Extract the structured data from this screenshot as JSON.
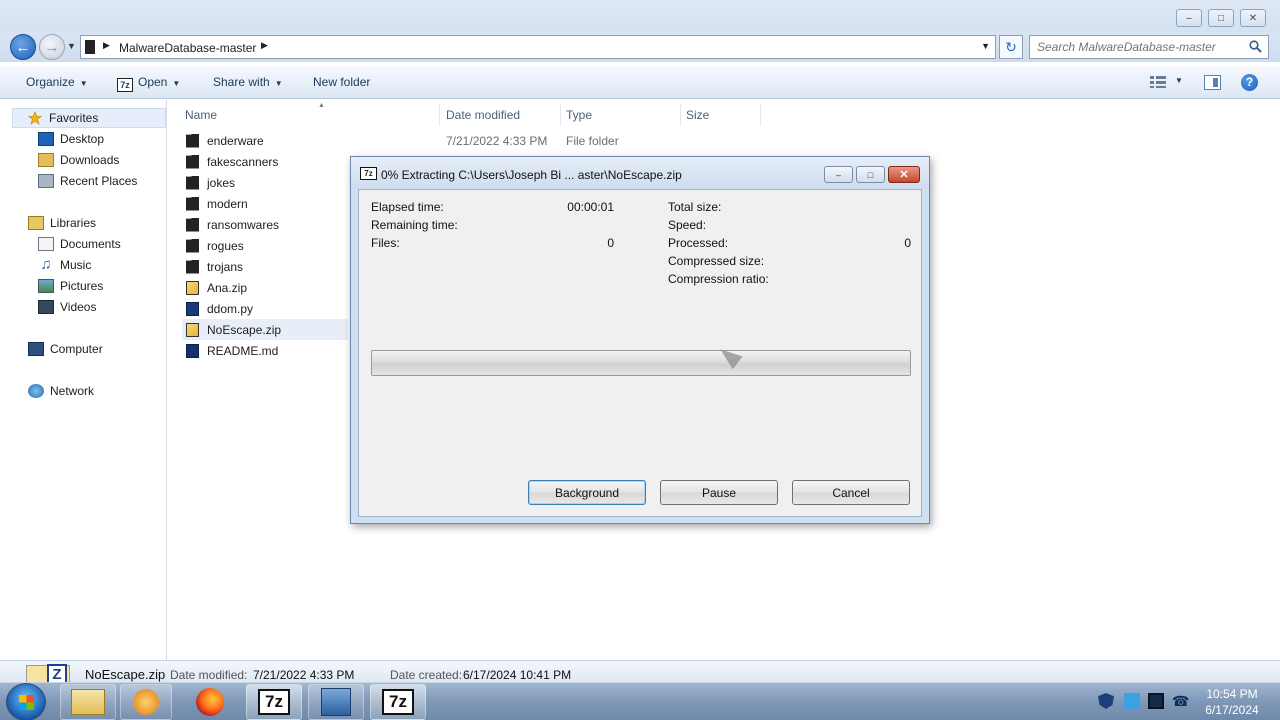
{
  "explorer": {
    "address": {
      "path": "MalwareDatabase-master"
    },
    "search": {
      "placeholder": "Search MalwareDatabase-master"
    },
    "toolbar": {
      "organize": "Organize",
      "open": "Open",
      "open_icon_text": "7z",
      "share_with": "Share with",
      "new_folder": "New folder"
    },
    "nav": {
      "favorites": "Favorites",
      "desktop": "Desktop",
      "downloads": "Downloads",
      "recent_places": "Recent Places",
      "libraries": "Libraries",
      "documents": "Documents",
      "music": "Music",
      "pictures": "Pictures",
      "videos": "Videos",
      "computer": "Computer",
      "network": "Network"
    },
    "columns": {
      "name": "Name",
      "date_modified": "Date modified",
      "type": "Type",
      "size": "Size"
    },
    "files": [
      {
        "name": "enderware",
        "date": "7/21/2022 4:33 PM",
        "type": "File folder"
      },
      {
        "name": "fakescanners"
      },
      {
        "name": "jokes"
      },
      {
        "name": "modern"
      },
      {
        "name": "ransomwares"
      },
      {
        "name": "rogues"
      },
      {
        "name": "trojans"
      },
      {
        "name": "Ana.zip"
      },
      {
        "name": "ddom.py"
      },
      {
        "name": "NoEscape.zip"
      },
      {
        "name": "README.md"
      }
    ],
    "details": {
      "name": "NoEscape.zip",
      "date_modified_label": "Date modified:",
      "date_modified": "7/21/2022 4:33 PM",
      "date_created_label": "Date created:",
      "date_created": "6/17/2024 10:41 PM",
      "icon_text": "Z"
    }
  },
  "dialog": {
    "icon_text": "7z",
    "title": "0% Extracting C:\\Users\\Joseph Bi ... aster\\NoEscape.zip",
    "labels": {
      "elapsed": "Elapsed time:",
      "remaining": "Remaining time:",
      "files": "Files:",
      "total_size": "Total size:",
      "speed": "Speed:",
      "processed": "Processed:",
      "compressed_size": "Compressed size:",
      "compression_ratio": "Compression ratio:"
    },
    "values": {
      "elapsed": "00:00:01",
      "files": "0",
      "processed": "0"
    },
    "progress_percent": 0,
    "buttons": {
      "background": "Background",
      "pause": "Pause",
      "cancel": "Cancel"
    }
  },
  "taskbar": {
    "app_7z_text": "7z",
    "time": "10:54 PM",
    "date": "6/17/2024"
  }
}
